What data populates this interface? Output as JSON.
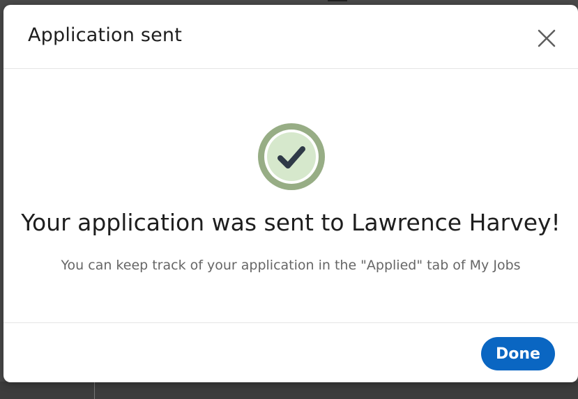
{
  "modal": {
    "title": "Application sent",
    "close_icon": "close-icon",
    "success_icon": "check-circle-icon",
    "headline": "Your application was sent to Lawrence Harvey!",
    "subtext": "You can keep track of your application in the \"Applied\" tab of My Jobs",
    "done_label": "Done"
  },
  "colors": {
    "accent": "#0a66c2",
    "success_ring": "#97ad85",
    "success_fill": "#d6e8cc",
    "check": "#2f3a47"
  }
}
